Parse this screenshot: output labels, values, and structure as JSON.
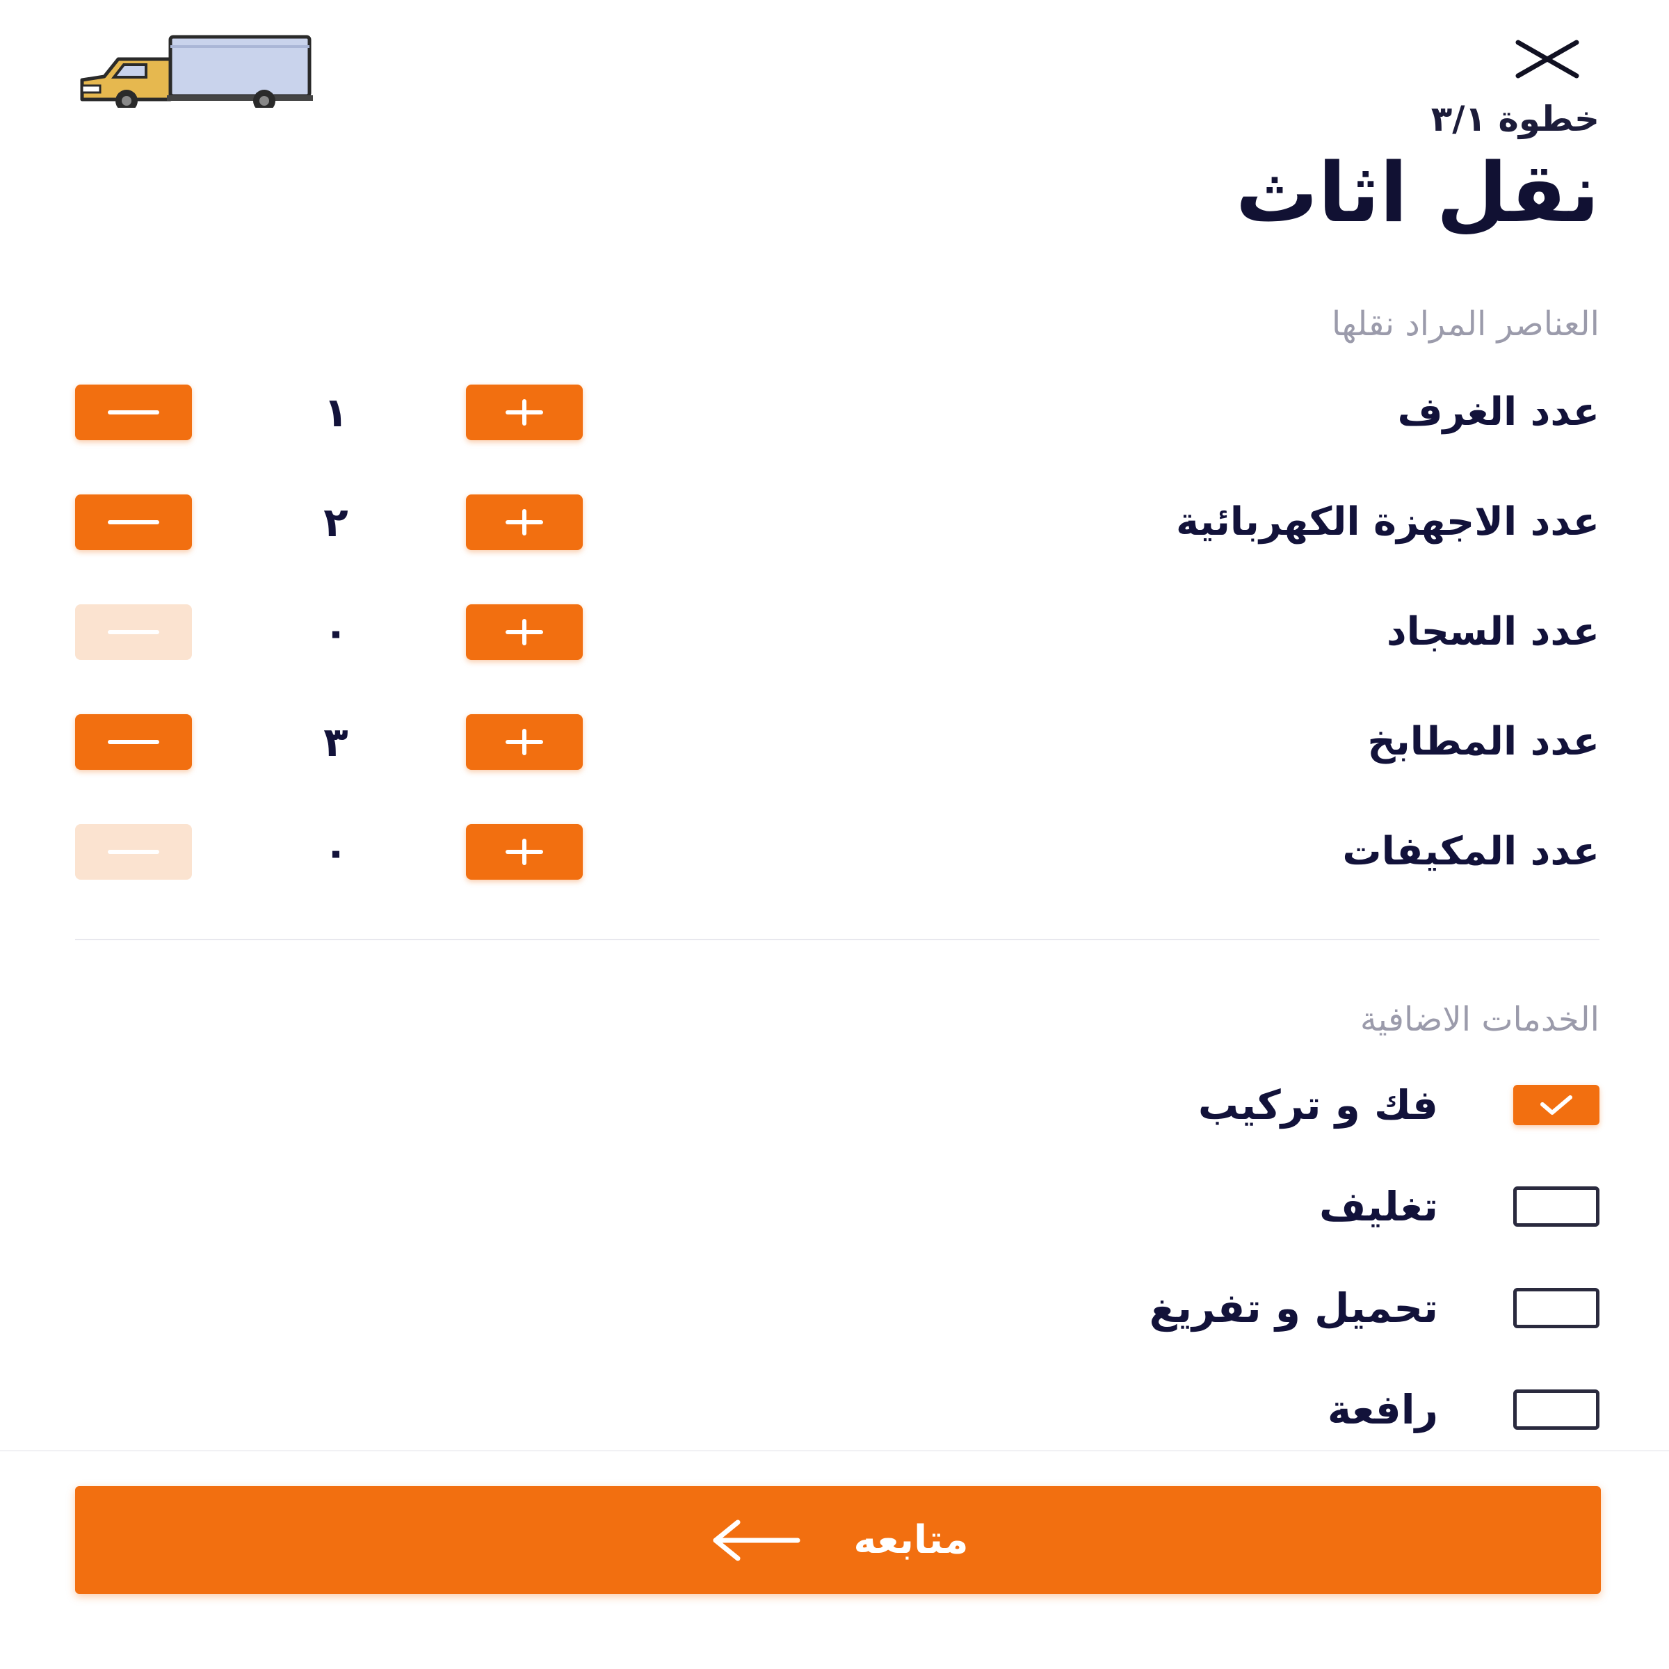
{
  "header": {
    "step": "خطوة ٣/١",
    "title": "نقل اثاث",
    "close_icon": "close-icon",
    "truck_icon": "truck-icon"
  },
  "items_section": {
    "title": "العناصر المراد نقلها",
    "counters": [
      {
        "label": "عدد الغرف",
        "value": "١",
        "minus_enabled": true
      },
      {
        "label": "عدد الاجهزة الكهربائية",
        "value": "٢",
        "minus_enabled": true
      },
      {
        "label": "عدد السجاد",
        "value": "٠",
        "minus_enabled": false
      },
      {
        "label": "عدد المطابخ",
        "value": "٣",
        "minus_enabled": true
      },
      {
        "label": "عدد المكيفات",
        "value": "٠",
        "minus_enabled": false
      }
    ]
  },
  "services_section": {
    "title": "الخدمات الاضافية",
    "options": [
      {
        "label": "فك و تركيب",
        "checked": true
      },
      {
        "label": "تغليف",
        "checked": false
      },
      {
        "label": "تحميل و تفريغ",
        "checked": false
      },
      {
        "label": "رافعة",
        "checked": false
      }
    ]
  },
  "footer": {
    "continue_label": "متابعه",
    "arrow_icon": "arrow-left-icon"
  },
  "colors": {
    "accent": "#f26f10",
    "accent_disabled": "#fbe3d0",
    "text": "#12123a",
    "muted": "#9b9bab"
  }
}
